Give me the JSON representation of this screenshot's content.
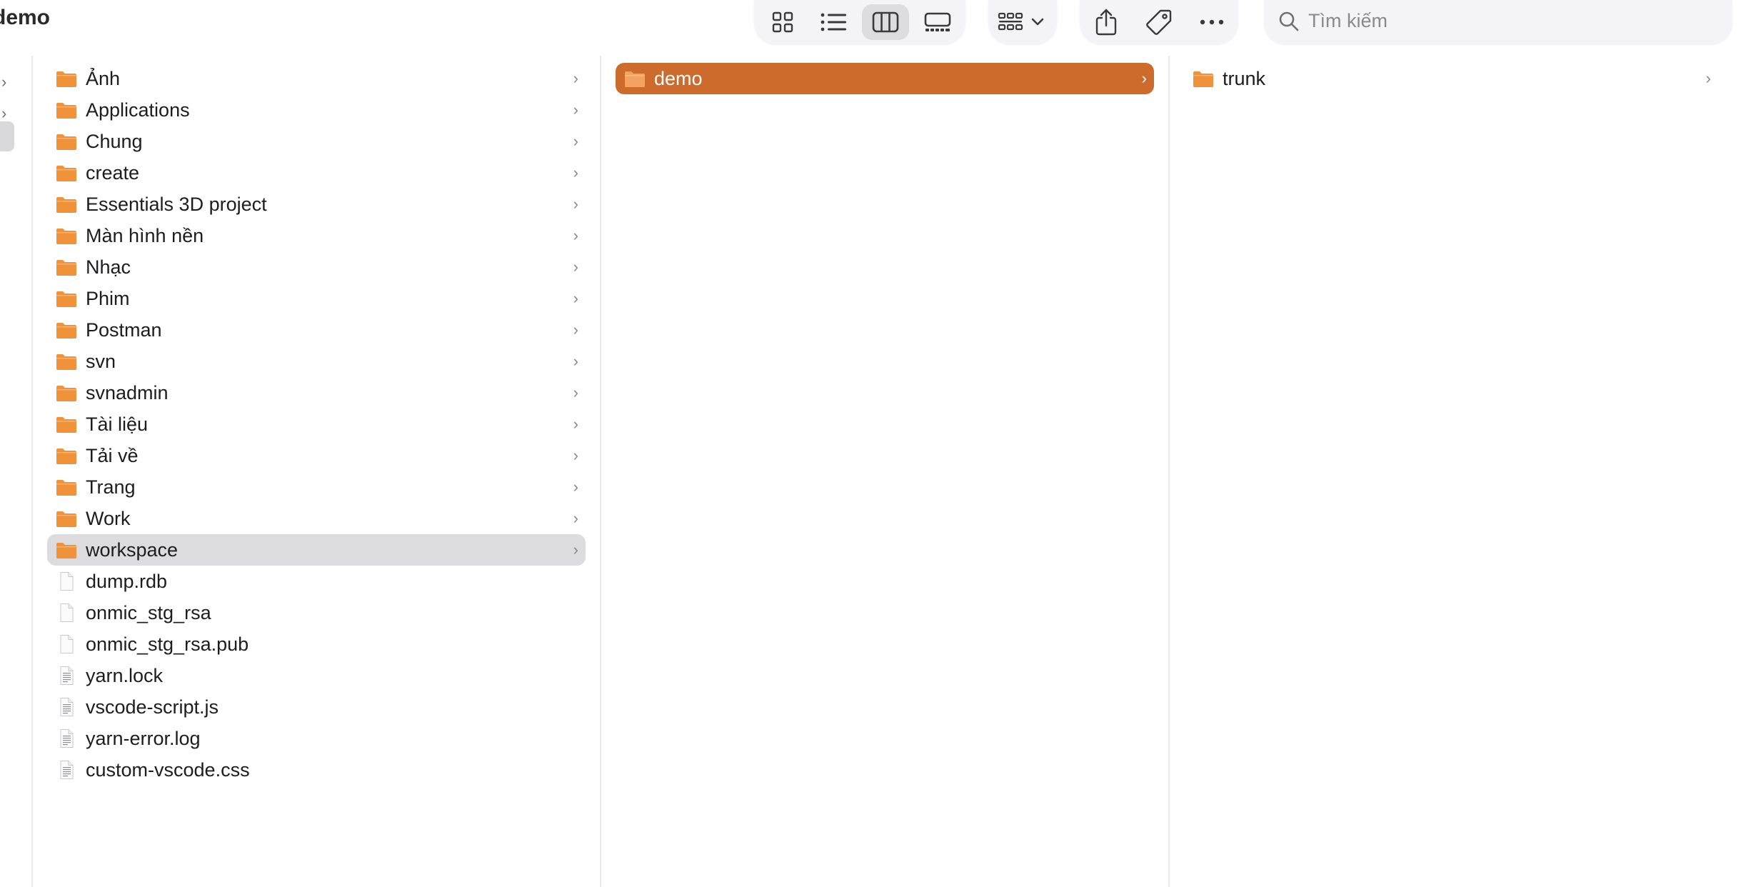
{
  "window": {
    "title": "demo"
  },
  "toolbar": {
    "view_buttons": [
      {
        "name": "icon-view",
        "icon": "grid-icon",
        "active": false
      },
      {
        "name": "list-view",
        "icon": "list-icon",
        "active": false
      },
      {
        "name": "column-view",
        "icon": "columns-icon",
        "active": true
      },
      {
        "name": "gallery-view",
        "icon": "gallery-icon",
        "active": false
      }
    ],
    "group_button": {
      "icon": "group-by-icon"
    },
    "actions": [
      {
        "name": "share",
        "icon": "share-icon"
      },
      {
        "name": "tag",
        "icon": "tag-icon"
      },
      {
        "name": "more",
        "icon": "ellipsis-icon"
      }
    ],
    "search": {
      "placeholder": "Tìm kiếm",
      "value": ""
    }
  },
  "colors": {
    "accent": "#cd6b2c",
    "folder": "#f0923a",
    "selection_gray": "#dcdcde"
  },
  "column1": {
    "selected_index": 15,
    "items": [
      {
        "label": "Ảnh",
        "kind": "folder",
        "has_children": true
      },
      {
        "label": "Applications",
        "kind": "folder",
        "has_children": true
      },
      {
        "label": "Chung",
        "kind": "folder",
        "has_children": true
      },
      {
        "label": "create",
        "kind": "folder",
        "has_children": true
      },
      {
        "label": "Essentials 3D project",
        "kind": "folder",
        "has_children": true
      },
      {
        "label": "Màn hình nền",
        "kind": "folder",
        "has_children": true
      },
      {
        "label": "Nhạc",
        "kind": "folder",
        "has_children": true
      },
      {
        "label": "Phim",
        "kind": "folder",
        "has_children": true
      },
      {
        "label": "Postman",
        "kind": "folder",
        "has_children": true
      },
      {
        "label": "svn",
        "kind": "folder",
        "has_children": true
      },
      {
        "label": "svnadmin",
        "kind": "folder",
        "has_children": true
      },
      {
        "label": "Tài liệu",
        "kind": "folder",
        "has_children": true
      },
      {
        "label": "Tải về",
        "kind": "folder",
        "has_children": true
      },
      {
        "label": "Trang",
        "kind": "folder",
        "has_children": true
      },
      {
        "label": "Work",
        "kind": "folder",
        "has_children": true
      },
      {
        "label": "workspace",
        "kind": "folder",
        "has_children": true
      },
      {
        "label": "dump.rdb",
        "kind": "file",
        "has_children": false
      },
      {
        "label": "onmic_stg_rsa",
        "kind": "file",
        "has_children": false
      },
      {
        "label": "onmic_stg_rsa.pub",
        "kind": "file",
        "has_children": false
      },
      {
        "label": "yarn.lock",
        "kind": "text-file",
        "has_children": false
      },
      {
        "label": "vscode-script.js",
        "kind": "text-file",
        "has_children": false
      },
      {
        "label": "yarn-error.log",
        "kind": "text-file",
        "has_children": false
      },
      {
        "label": "custom-vscode.css",
        "kind": "text-file",
        "has_children": false
      }
    ]
  },
  "column2": {
    "selected_index": 0,
    "items": [
      {
        "label": "demo",
        "kind": "folder",
        "has_children": true
      }
    ]
  },
  "column3": {
    "items": [
      {
        "label": "trunk",
        "kind": "folder",
        "has_children": true
      }
    ]
  }
}
